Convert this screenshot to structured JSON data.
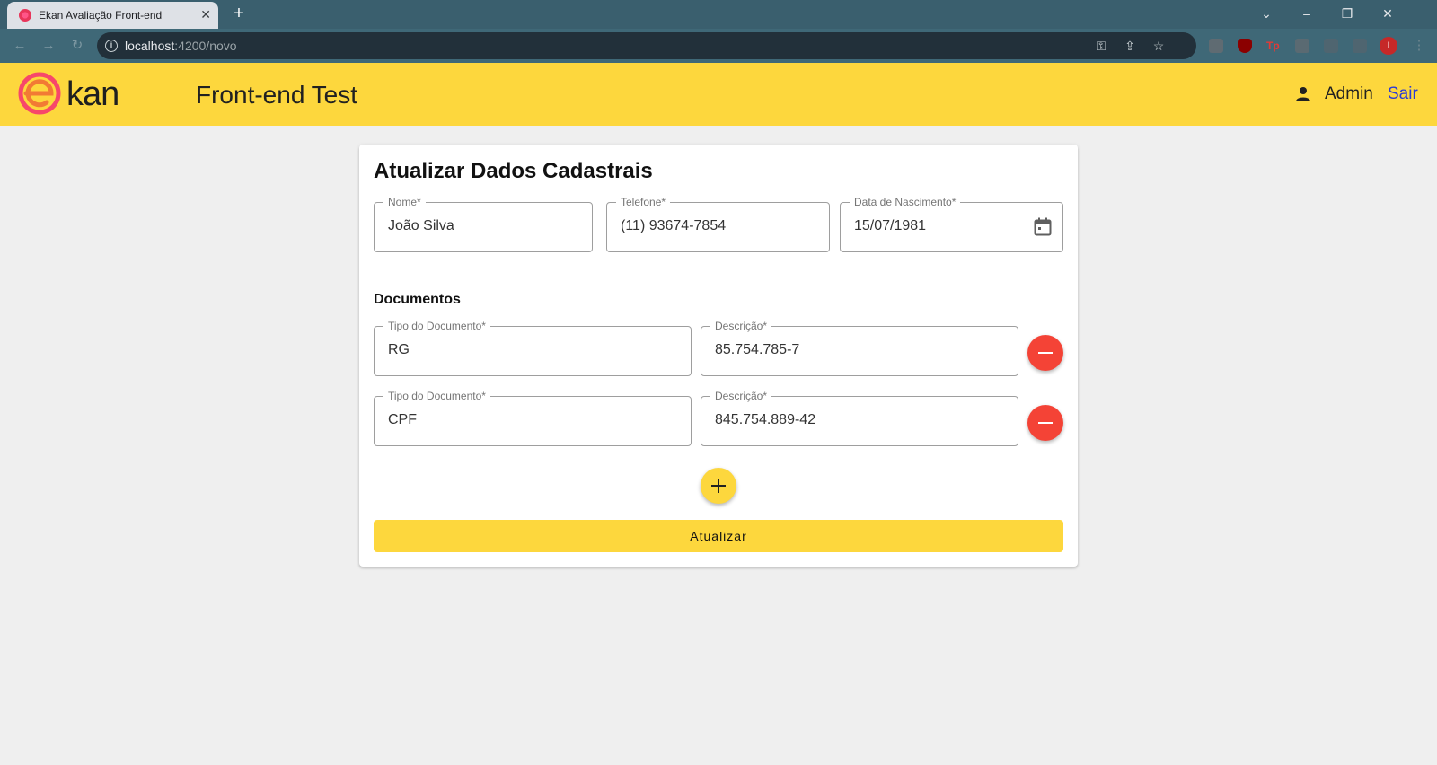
{
  "browser": {
    "tab_title": "Ekan Avaliação Front-end",
    "url_host": "localhost",
    "url_path": ":4200/novo",
    "extension_icons": [
      "settings-ext-icon",
      "ublock-icon",
      "tp-icon",
      "puzzle-icon",
      "reading-list-icon",
      "side-panel-icon"
    ],
    "profile_initial": "I"
  },
  "header": {
    "logo_text": "kan",
    "title": "Front-end Test",
    "user_name": "Admin",
    "logout_label": "Sair",
    "accent_color": "#fdd73d"
  },
  "form": {
    "title": "Atualizar Dados Cadastrais",
    "fields": {
      "nome": {
        "label": "Nome*",
        "value": "João Silva"
      },
      "telefone": {
        "label": "Telefone*",
        "value": "(11) 93674-7854"
      },
      "nascimento": {
        "label": "Data de Nascimento*",
        "value": "15/07/1981"
      }
    },
    "documents_title": "Documentos",
    "documents": [
      {
        "type_label": "Tipo do Documento*",
        "type_value": "RG",
        "desc_label": "Descrição*",
        "desc_value": "85.754.785-7"
      },
      {
        "type_label": "Tipo do Documento*",
        "type_value": "CPF",
        "desc_label": "Descrição*",
        "desc_value": "845.754.889-42"
      }
    ],
    "submit_label": "Atualizar",
    "remove_color": "#f44336"
  }
}
